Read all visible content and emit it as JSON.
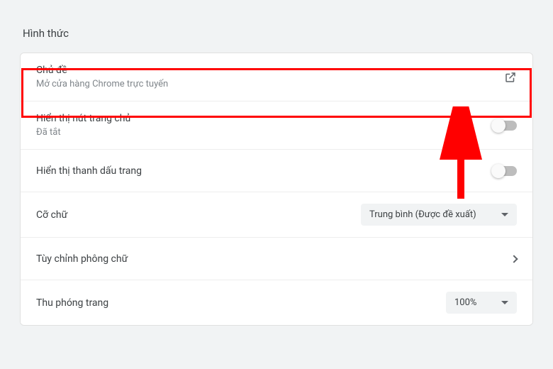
{
  "section_title": "Hình thức",
  "rows": {
    "theme": {
      "label": "Chủ đề",
      "sub": "Mở cửa hàng Chrome trực tuyến"
    },
    "home_button": {
      "label": "Hiển thị nút trang chủ",
      "sub": "Đã tắt",
      "toggle_on": false
    },
    "bookmarks_bar": {
      "label": "Hiển thị thanh dấu trang",
      "toggle_on": false
    },
    "font_size": {
      "label": "Cỡ chữ",
      "value": "Trung bình (Được đề xuất)"
    },
    "customize_fonts": {
      "label": "Tùy chỉnh phông chữ"
    },
    "page_zoom": {
      "label": "Thu phóng trang",
      "value": "100%"
    }
  },
  "annotation": {
    "highlight_target": "theme-row",
    "arrow_color": "#ff0000"
  }
}
